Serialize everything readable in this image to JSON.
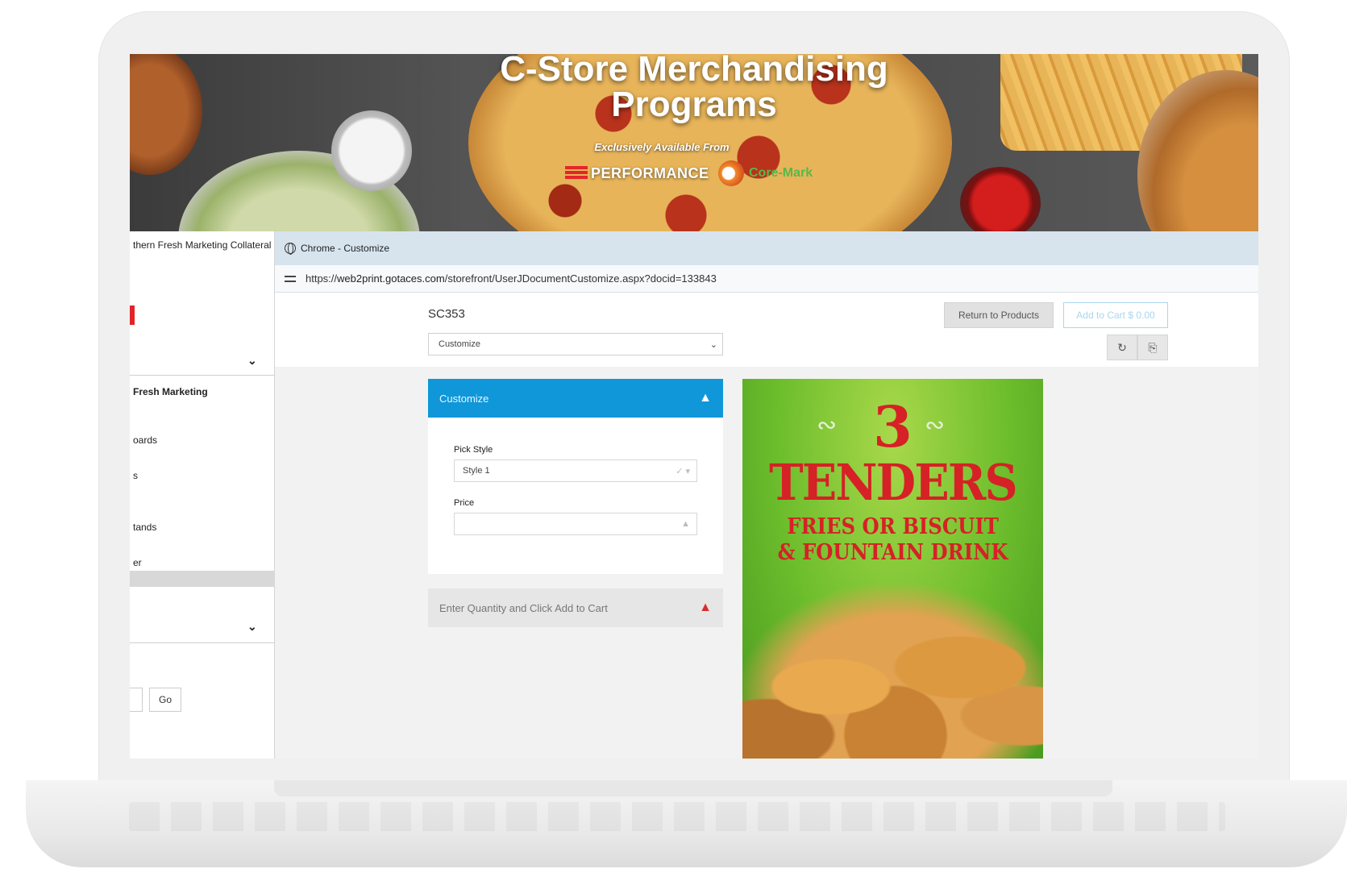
{
  "banner": {
    "title_line1": "C-Store Merchandising",
    "title_line2": "Programs",
    "subtitle": "Exclusively Available From",
    "logo_performance": "PERFORMANCE",
    "logo_coremark": "Core-Mark"
  },
  "sidebar": {
    "title": "thern Fresh Marketing Collateral",
    "section": "Fresh Marketing",
    "items": [
      "oards",
      "s",
      "tands",
      "er"
    ],
    "go_label": "Go"
  },
  "browser": {
    "title": "Chrome - Customize",
    "url_prefix": "https://",
    "url_domain": "web2print.gotaces.com",
    "url_path": "/storefront/UserJDocumentCustomize.aspx?docid=133843"
  },
  "page": {
    "doc_code": "SC353",
    "view_select": "Customize",
    "return_label": "Return to Products",
    "cart_label": "Add to Cart $ 0.00"
  },
  "customize_panel": {
    "header": "Customize",
    "pick_style_label": "Pick Style",
    "pick_style_value": "Style 1",
    "price_label": "Price",
    "price_value": "",
    "qty_message": "Enter Quantity and Click Add to Cart"
  },
  "poster": {
    "number": "3",
    "headline": "TENDERS",
    "line2": "FRIES OR BISCUIT",
    "line3": "& FOUNTAIN DRINK"
  }
}
